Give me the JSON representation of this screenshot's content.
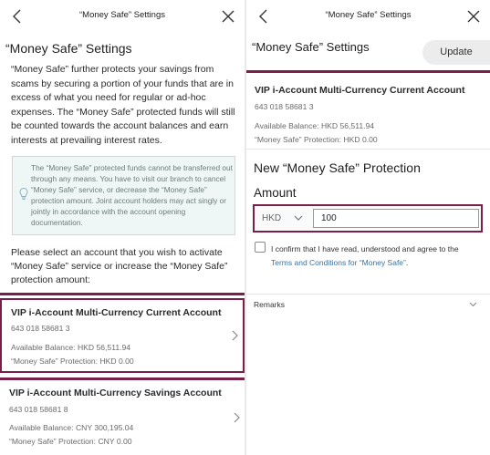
{
  "left": {
    "nav_title": "“Money Safe” Settings",
    "heading": "“Money Safe” Settings",
    "description": "“Money Safe” further protects your savings from scams by securing a portion of your funds that are in excess of what you need for regular or ad-hoc expenses. The “Money Safe” protected funds will still be counted towards the account balances and earn interests at prevailing interest rates.",
    "notice": "The “Money Safe” protected funds cannot be transferred out through any means. You have to visit our branch to cancel “Money Safe” service, or decrease the “Money Safe” protection amount. Joint account holders may act singly or jointly in accordance with the account opening documentation.",
    "select_prompt": "Please select an account that you wish to activate “Money Safe” service or increase the “Money Safe” protection amount:",
    "accounts": [
      {
        "name": "VIP i-Account Multi-Currency Current Account",
        "number": "643 018 58681 3",
        "balance": "Available Balance: HKD 56,511.94",
        "protection": "“Money Safe” Protection: HKD 0.00"
      },
      {
        "name": "VIP i-Account Multi-Currency Savings Account",
        "number": "643 018 58681 8",
        "balance": "Available Balance: CNY 300,195.04",
        "protection": "“Money Safe” Protection: CNY 0.00"
      }
    ]
  },
  "right": {
    "nav_title": "“Money Safe” Settings",
    "heading": "“Money Safe” Settings",
    "update_label": "Update",
    "account": {
      "name": "VIP i-Account Multi-Currency Current Account",
      "number": "643 018 58681 3",
      "balance": "Available Balance: HKD 56,511.94",
      "protection": "“Money Safe” Protection: HKD 0.00"
    },
    "new_protection_title": "New “Money Safe” Protection",
    "amount_label": "Amount",
    "currency": "HKD",
    "amount_value": "100",
    "confirm_text": "I confirm that I have read, understood and agree to the",
    "terms_link": "Terms and Conditions for “Money Safe”",
    "terms_suffix": ".",
    "remarks_label": "Remarks"
  },
  "colors": {
    "accent": "#7a1f4a",
    "notice_bg": "#eef7f5",
    "link": "#3a6f9c"
  },
  "icons": [
    "chevron-left-icon",
    "close-icon",
    "lightbulb-icon",
    "chevron-right-icon",
    "chevron-down-icon"
  ]
}
